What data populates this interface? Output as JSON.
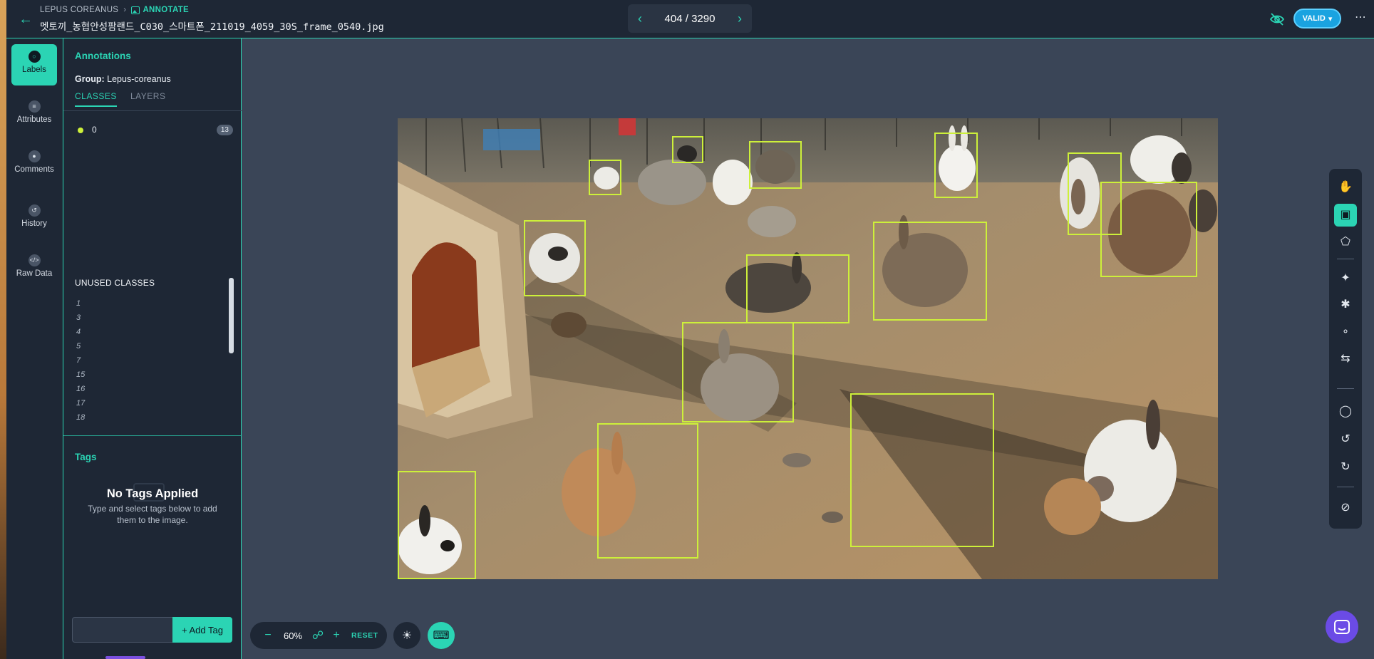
{
  "header": {
    "project": "LEPUS COREANUS",
    "section": "ANNOTATE",
    "filename": "멧토끼_농협안성팜랜드_C030_스마트폰_211019_4059_30S_frame_0540.jpg",
    "pager": "404 / 3290",
    "status_label": "VALID",
    "back_icon": "arrow-left-icon",
    "more_icon": "more-horizontal-icon"
  },
  "rail": {
    "items": [
      {
        "label": "Labels",
        "icon": "tag-icon",
        "active": true
      },
      {
        "label": "Attributes",
        "icon": "list-icon"
      },
      {
        "label": "Comments",
        "icon": "comment-icon"
      },
      {
        "label": "History",
        "icon": "history-icon"
      },
      {
        "label": "Raw Data",
        "icon": "code-icon"
      }
    ]
  },
  "panel": {
    "title": "Annotations",
    "group_label": "Group:",
    "group_value": "Lepus-coreanus",
    "tabs": [
      "CLASSES",
      "LAYERS"
    ],
    "classes": [
      {
        "name": "0",
        "count": "13",
        "color": "#cdf03a"
      }
    ],
    "unused_title": "UNUSED CLASSES",
    "unused": [
      "1",
      "3",
      "4",
      "5",
      "7",
      "15",
      "16",
      "17",
      "18"
    ],
    "tags_title": "Tags",
    "tags_empty_title": "No Tags Applied",
    "tags_empty_sub": "Type and select tags below to add them to the image.",
    "add_tag_label": "+ Add Tag",
    "tag_input_placeholder": ""
  },
  "canvas": {
    "box_color": "#cdf03a",
    "box_count": 13
  },
  "zoom": {
    "value": "60%",
    "reset_label": "RESET"
  },
  "toolbar": {
    "tools": [
      "pan-hand-icon",
      "bounding-box-icon",
      "polygon-icon",
      "smart-select-icon",
      "magic-wand-icon",
      "keypoint-icon",
      "repeat-icon",
      "comment-icon",
      "undo-icon",
      "redo-icon",
      "hide-annotations-icon"
    ],
    "active": "bounding-box-icon"
  },
  "colors": {
    "accent": "#2bd4b4",
    "panel_bg": "#1e2735",
    "canvas_bg": "#3a4557",
    "valid_blue": "#1aa3e0"
  }
}
